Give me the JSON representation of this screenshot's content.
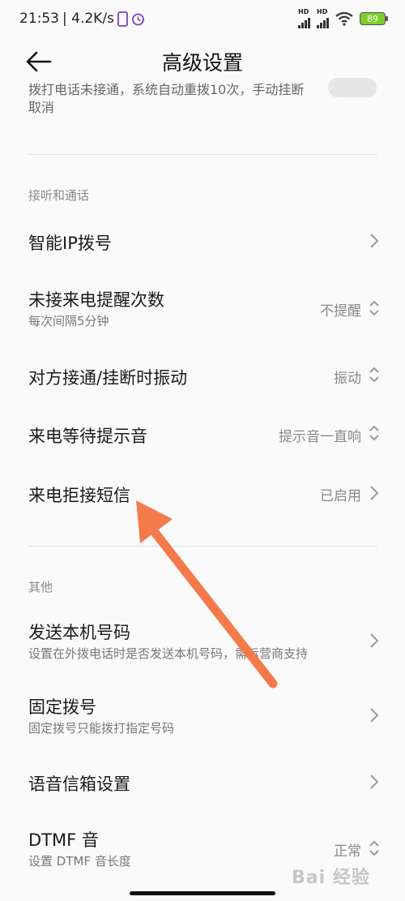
{
  "status_bar": {
    "time": "21:53",
    "speed": "| 4.2K/s",
    "hd1": "HD",
    "hd2": "HD",
    "battery": "89"
  },
  "header": {
    "title": "高级设置"
  },
  "partial_item": {
    "text": "拨打电话未接通，系统自动重拨10次，手动挂断取消"
  },
  "sections": [
    {
      "label": "接听和通话",
      "items": [
        {
          "title": "智能IP拨号",
          "subtitle": "",
          "value": "",
          "control": "chevron-right"
        },
        {
          "title": "未接来电提醒次数",
          "subtitle": "每次间隔5分钟",
          "value": "不提醒",
          "control": "up-down"
        },
        {
          "title": "对方接通/挂断时振动",
          "subtitle": "",
          "value": "振动",
          "control": "up-down"
        },
        {
          "title": "来电等待提示音",
          "subtitle": "",
          "value": "提示音一直响",
          "control": "up-down"
        },
        {
          "title": "来电拒接短信",
          "subtitle": "",
          "value": "已启用",
          "control": "chevron-right"
        }
      ]
    },
    {
      "label": "其他",
      "items": [
        {
          "title": "发送本机号码",
          "subtitle": "设置在外拨电话时是否发送本机号码，需运营商支持",
          "value": "",
          "control": "chevron-right"
        },
        {
          "title": "固定拨号",
          "subtitle": "固定拨号只能拨打指定号码",
          "value": "",
          "control": "chevron-right"
        },
        {
          "title": "语音信箱设置",
          "subtitle": "",
          "value": "",
          "control": "chevron-right"
        },
        {
          "title": "DTMF 音",
          "subtitle": "设置 DTMF 音长度",
          "value": "正常",
          "control": "up-down"
        }
      ]
    }
  ],
  "annotation": {
    "arrow_color": "#f47a4c"
  },
  "watermark": {
    "text": "Bai 经验"
  },
  "colors": {
    "background": "#fafafa",
    "divider": "#e2e2e2",
    "secondary_text": "#888888"
  }
}
